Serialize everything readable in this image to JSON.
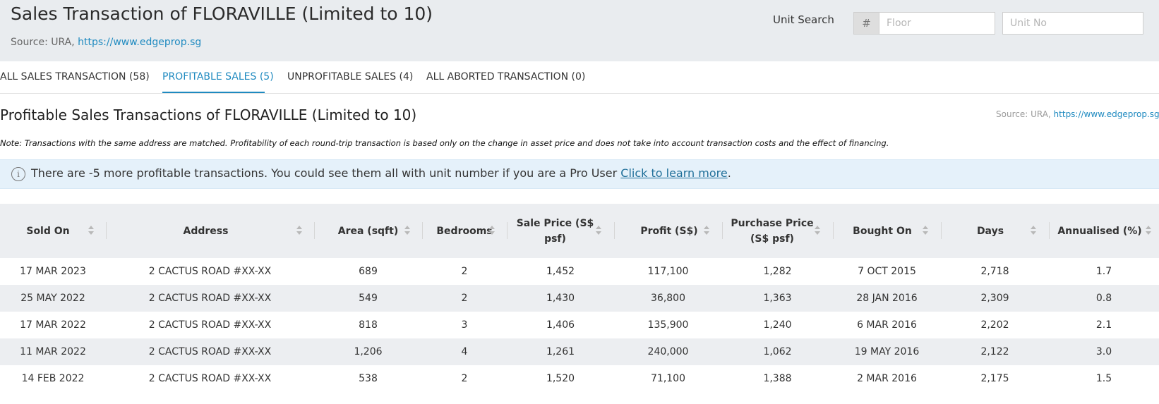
{
  "header": {
    "title": "Sales Transaction of FLORAVILLE (Limited to 10)",
    "source_prefix": "Source: URA, ",
    "source_link": "https://www.edgeprop.sg"
  },
  "unit_search": {
    "label": "Unit Search",
    "hash": "#",
    "floor_placeholder": "Floor",
    "unit_placeholder": "Unit No"
  },
  "tabs": [
    {
      "label": "ALL SALES TRANSACTION (58)",
      "active": false
    },
    {
      "label": "PROFITABLE SALES (5)",
      "active": true
    },
    {
      "label": "UNPROFITABLE SALES (4)",
      "active": false
    },
    {
      "label": "ALL ABORTED TRANSACTION (0)",
      "active": false
    }
  ],
  "section": {
    "title": "Profitable Sales Transactions of FLORAVILLE (Limited to 10)",
    "source_prefix": "Source: URA, ",
    "source_link": "https://www.edgeprop.sg",
    "note": "Note: Transactions with the same address are matched. Profitability of each round-trip transaction is based only on the change in asset price and does not take into account transaction costs and the effect of financing."
  },
  "info": {
    "icon": "i",
    "text": "There are -5 more profitable transactions. You could see them all with unit number if you are a Pro User ",
    "link": "Click to learn more",
    "suffix": "."
  },
  "table": {
    "columns": [
      {
        "line1": "Sold On",
        "line2": ""
      },
      {
        "line1": "Address",
        "line2": ""
      },
      {
        "line1": "Area (sqft)",
        "line2": ""
      },
      {
        "line1": "Bedrooms",
        "line2": ""
      },
      {
        "line1": "Sale Price (S$",
        "line2": "psf)"
      },
      {
        "line1": "Profit (S$)",
        "line2": ""
      },
      {
        "line1": "Purchase Price",
        "line2": "(S$ psf)"
      },
      {
        "line1": "Bought On",
        "line2": ""
      },
      {
        "line1": "Days",
        "line2": ""
      },
      {
        "line1": "Annualised (%)",
        "line2": ""
      }
    ],
    "rows": [
      [
        "17 MAR 2023",
        "2 CACTUS ROAD #XX-XX",
        "689",
        "2",
        "1,452",
        "117,100",
        "1,282",
        "7 OCT 2015",
        "2,718",
        "1.7"
      ],
      [
        "25 MAY 2022",
        "2 CACTUS ROAD #XX-XX",
        "549",
        "2",
        "1,430",
        "36,800",
        "1,363",
        "28 JAN 2016",
        "2,309",
        "0.8"
      ],
      [
        "17 MAR 2022",
        "2 CACTUS ROAD #XX-XX",
        "818",
        "3",
        "1,406",
        "135,900",
        "1,240",
        "6 MAR 2016",
        "2,202",
        "2.1"
      ],
      [
        "11 MAR 2022",
        "2 CACTUS ROAD #XX-XX",
        "1,206",
        "4",
        "1,261",
        "240,000",
        "1,062",
        "19 MAY 2016",
        "2,122",
        "3.0"
      ],
      [
        "14 FEB 2022",
        "2 CACTUS ROAD #XX-XX",
        "538",
        "2",
        "1,520",
        "71,100",
        "1,388",
        "2 MAR 2016",
        "2,175",
        "1.5"
      ]
    ]
  }
}
